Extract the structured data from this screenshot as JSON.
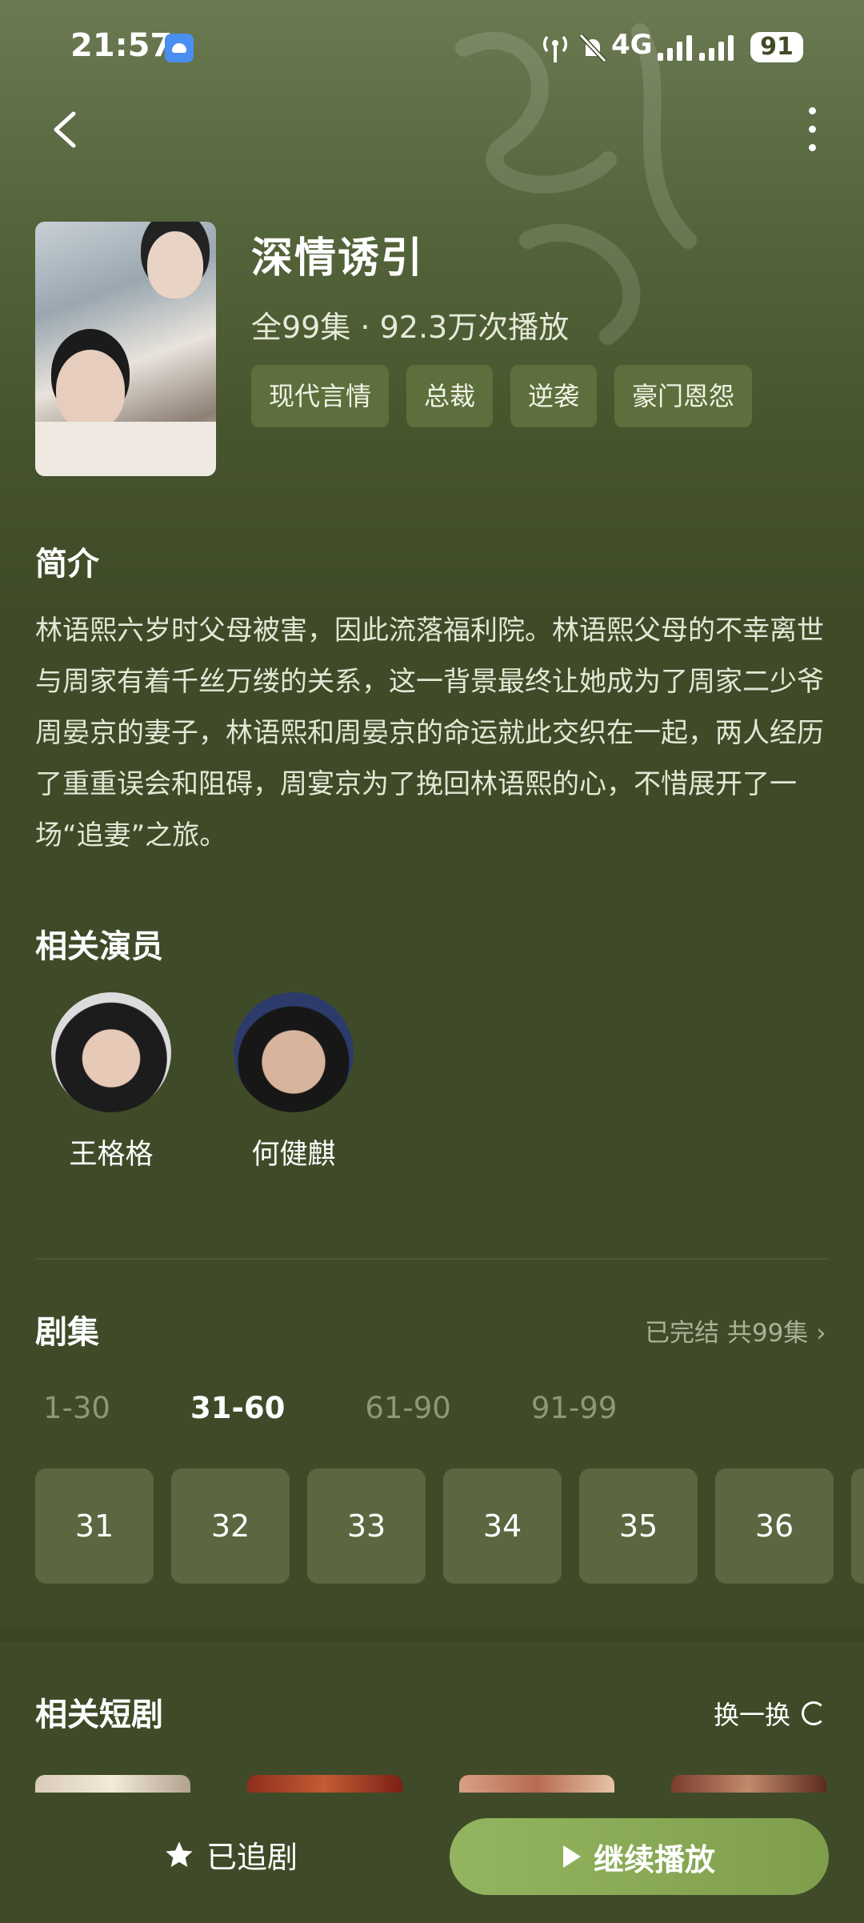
{
  "status_bar": {
    "time": "21:57",
    "network": "4G",
    "battery": "91"
  },
  "drama": {
    "title": "深情诱引",
    "meta": "全99集 · 92.3万次播放",
    "tags": [
      "现代言情",
      "总裁",
      "逆袭",
      "豪门恩怨"
    ]
  },
  "intro": {
    "heading": "简介",
    "text": "林语熙六岁时父母被害，因此流落福利院。林语熙父母的不幸离世与周家有着千丝万缕的关系，这一背景最终让她成为了周家二少爷周晏京的妻子，林语熙和周晏京的命运就此交织在一起，两人经历了重重误会和阻碍，周宴京为了挽回林语熙的心，不惜展开了一场“追妻”之旅。"
  },
  "actors": {
    "heading": "相关演员",
    "items": [
      {
        "name": "王格格"
      },
      {
        "name": "何健麒"
      }
    ]
  },
  "episodes": {
    "heading": "剧集",
    "status": "已完结 共99集",
    "ranges": [
      "1-30",
      "31-60",
      "61-90",
      "91-99"
    ],
    "active_range": "31-60",
    "items": [
      "31",
      "32",
      "33",
      "34",
      "35",
      "36"
    ]
  },
  "related": {
    "heading": "相关短剧",
    "refresh_label": "换一换"
  },
  "bottom": {
    "follow_label": "已追剧",
    "play_label": "继续播放"
  },
  "colors": {
    "background": "#3f4b28",
    "tag_bg": "#5d6f3c",
    "play_button": "#8aad56"
  }
}
